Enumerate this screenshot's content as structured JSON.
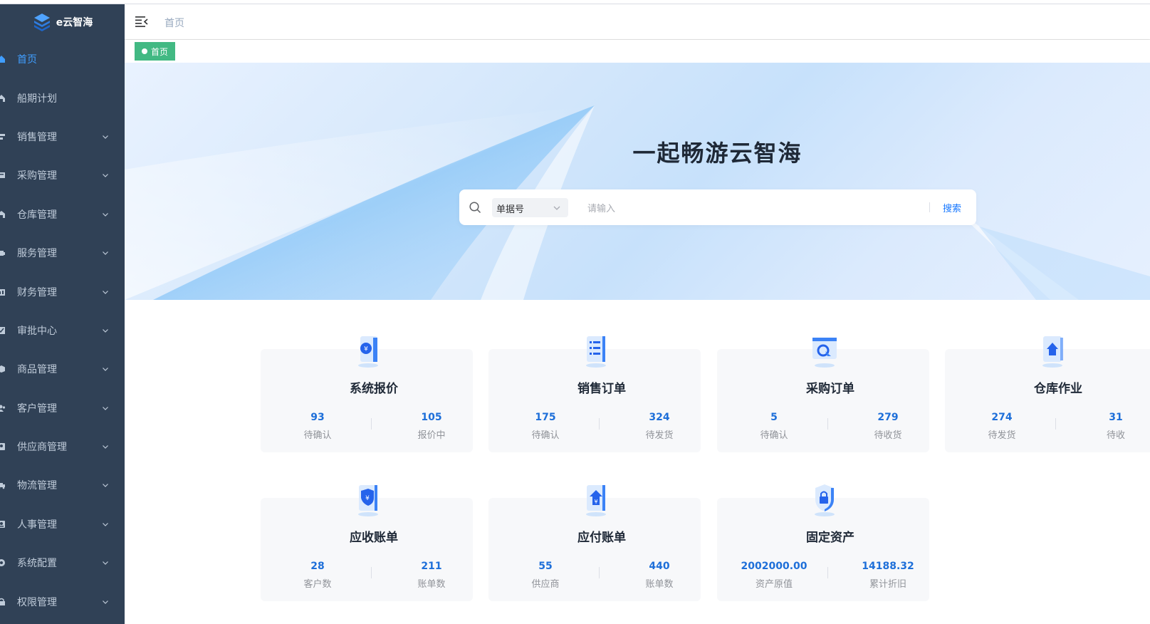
{
  "app": {
    "logo_text": "e云智海"
  },
  "sidebar": {
    "items": [
      {
        "label": "首页",
        "icon": "home-icon",
        "active": true,
        "has_children": false
      },
      {
        "label": "船期计划",
        "icon": "ship-icon",
        "active": false,
        "has_children": false
      },
      {
        "label": "销售管理",
        "icon": "sales-icon",
        "active": false,
        "has_children": true
      },
      {
        "label": "采购管理",
        "icon": "purchase-icon",
        "active": false,
        "has_children": true
      },
      {
        "label": "仓库管理",
        "icon": "warehouse-icon",
        "active": false,
        "has_children": true
      },
      {
        "label": "服务管理",
        "icon": "service-icon",
        "active": false,
        "has_children": true
      },
      {
        "label": "财务管理",
        "icon": "finance-icon",
        "active": false,
        "has_children": true
      },
      {
        "label": "审批中心",
        "icon": "approval-icon",
        "active": false,
        "has_children": true
      },
      {
        "label": "商品管理",
        "icon": "goods-icon",
        "active": false,
        "has_children": true
      },
      {
        "label": "客户管理",
        "icon": "customer-icon",
        "active": false,
        "has_children": true
      },
      {
        "label": "供应商管理",
        "icon": "supplier-icon",
        "active": false,
        "has_children": true
      },
      {
        "label": "物流管理",
        "icon": "logistics-icon",
        "active": false,
        "has_children": true
      },
      {
        "label": "人事管理",
        "icon": "hr-icon",
        "active": false,
        "has_children": true
      },
      {
        "label": "系统配置",
        "icon": "settings-icon",
        "active": false,
        "has_children": true
      },
      {
        "label": "权限管理",
        "icon": "lock-icon",
        "active": false,
        "has_children": true
      }
    ]
  },
  "navbar": {
    "breadcrumb": "首页"
  },
  "tags": [
    {
      "label": "首页",
      "active": true
    }
  ],
  "banner": {
    "title": "一起畅游云智海",
    "search": {
      "select_value": "单据号",
      "placeholder": "请输入",
      "button": "搜索"
    }
  },
  "cards": [
    {
      "title": "系统报价",
      "icon": "quotation-icon",
      "stats": [
        {
          "value": "93",
          "label": "待确认"
        },
        {
          "value": "105",
          "label": "报价中"
        }
      ]
    },
    {
      "title": "销售订单",
      "icon": "sales-order-icon",
      "stats": [
        {
          "value": "175",
          "label": "待确认"
        },
        {
          "value": "324",
          "label": "待发货"
        }
      ]
    },
    {
      "title": "采购订单",
      "icon": "purchase-order-icon",
      "stats": [
        {
          "value": "5",
          "label": "待确认"
        },
        {
          "value": "279",
          "label": "待收货"
        }
      ]
    },
    {
      "title": "仓库作业",
      "icon": "warehouse-task-icon",
      "stats": [
        {
          "value": "274",
          "label": "待发货"
        },
        {
          "value": "31",
          "label": "待收"
        }
      ]
    },
    {
      "title": "应收账单",
      "icon": "receivable-icon",
      "stats": [
        {
          "value": "28",
          "label": "客户数"
        },
        {
          "value": "211",
          "label": "账单数"
        }
      ]
    },
    {
      "title": "应付账单",
      "icon": "payable-icon",
      "stats": [
        {
          "value": "55",
          "label": "供应商"
        },
        {
          "value": "440",
          "label": "账单数"
        }
      ]
    },
    {
      "title": "固定资产",
      "icon": "fixed-asset-icon",
      "stats": [
        {
          "value": "2002000.00",
          "label": "资产原值"
        },
        {
          "value": "14188.32",
          "label": "累计折旧"
        }
      ]
    }
  ],
  "colors": {
    "sidebar_bg": "#304156",
    "accent": "#409eff",
    "tag_green": "#42b983",
    "stat_blue": "#1e6fd9"
  }
}
